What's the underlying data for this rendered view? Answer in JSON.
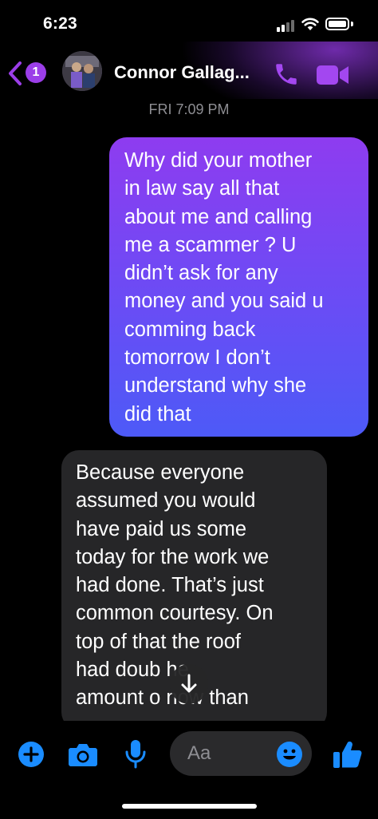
{
  "status_bar": {
    "time": "6:23"
  },
  "header": {
    "back_badge_count": "1",
    "contact_name": "Connor Gallag...",
    "accent_color": "#9b3ee8"
  },
  "conversation": {
    "timestamp": "FRI 7:09 PM",
    "messages": [
      {
        "direction": "sent",
        "text": "Why did your mother\nin law say all that\nabout me and calling\nme a scammer ? U\ndidn’t ask for any\nmoney and you said u\ncomming back\ntomorrow I don’t\nunderstand  why she\ndid that"
      },
      {
        "direction": "received",
        "text": "Because everyone\nassumed you would\nhave paid us some\ntoday for the work we\nhad done. That’s just\ncommon courtesy. On\ntop of that the roof\nhad doub  he\namount o  now than"
      }
    ]
  },
  "composer": {
    "placeholder": "Aa",
    "icons": [
      "plus-icon",
      "camera-icon",
      "microphone-icon",
      "emoji-icon",
      "thumbs-up-icon"
    ],
    "icon_color": "#1a8cff"
  }
}
